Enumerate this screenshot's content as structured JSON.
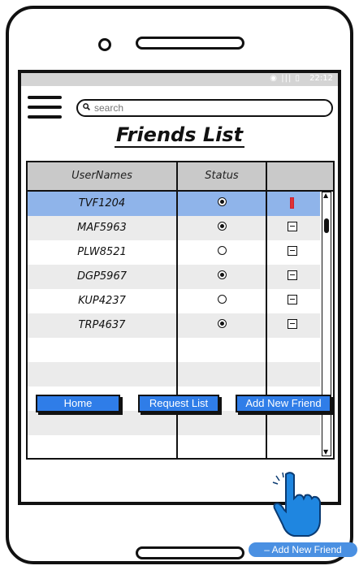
{
  "statusbar": {
    "icons": "◉ ||| ▯",
    "time": "22:12"
  },
  "search": {
    "placeholder": "search"
  },
  "page": {
    "title": "Friends List"
  },
  "table": {
    "headers": [
      "UserNames",
      "Status",
      ""
    ],
    "rows": [
      {
        "username": "TVF1204",
        "online": true,
        "selected": true
      },
      {
        "username": "MAF5963",
        "online": true
      },
      {
        "username": "PLW8521",
        "online": false
      },
      {
        "username": "DGP5967",
        "online": true
      },
      {
        "username": "KUP4237",
        "online": false
      },
      {
        "username": "TRP4637",
        "online": true
      }
    ]
  },
  "buttons": {
    "home": "Home",
    "request_list": "Request List",
    "add_new_friend": "Add New Friend"
  },
  "tooltip": {
    "label": "– Add New Friend"
  },
  "colors": {
    "button": "#2f7de8",
    "selected_row": "#8fb4ea",
    "tooltip": "#4a90e2"
  }
}
